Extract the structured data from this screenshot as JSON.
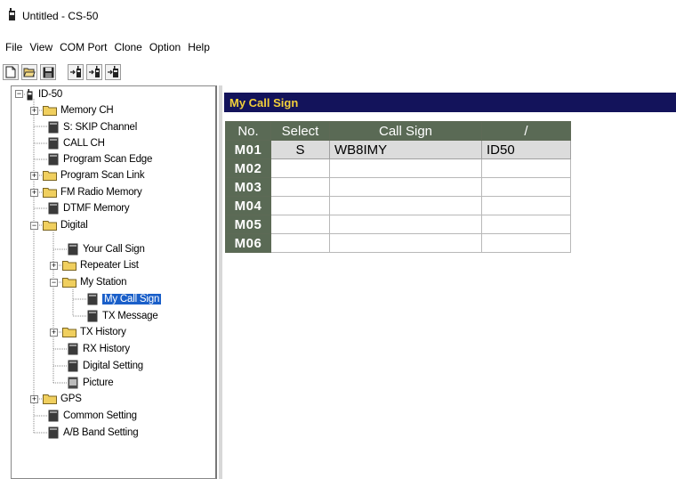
{
  "window": {
    "title": "Untitled - CS-50"
  },
  "menu": [
    "File",
    "View",
    "COM Port",
    "Clone",
    "Option",
    "Help"
  ],
  "toolbar": {
    "buttons": [
      "new-file-icon",
      "open-folder-icon",
      "save-icon",
      "read-radio-icon",
      "write-radio-icon",
      "write-radio-alt-icon"
    ]
  },
  "tree": {
    "root": "ID-50",
    "items": [
      {
        "label": "Memory CH"
      },
      {
        "label": "S: SKIP Channel"
      },
      {
        "label": "CALL CH"
      },
      {
        "label": "Program Scan Edge"
      },
      {
        "label": "Program Scan Link"
      },
      {
        "label": "FM Radio Memory"
      },
      {
        "label": "DTMF Memory"
      },
      {
        "label": "Digital"
      },
      {
        "label": "Your Call Sign"
      },
      {
        "label": "Repeater List"
      },
      {
        "label": "My Station"
      },
      {
        "label": "My Call Sign"
      },
      {
        "label": "TX Message"
      },
      {
        "label": "TX History"
      },
      {
        "label": "RX History"
      },
      {
        "label": "Digital Setting"
      },
      {
        "label": "Picture"
      },
      {
        "label": "GPS"
      },
      {
        "label": "Common Setting"
      },
      {
        "label": "A/B Band Setting"
      }
    ]
  },
  "content": {
    "header": "My Call Sign",
    "columns": [
      "No.",
      "Select",
      "Call Sign",
      "/"
    ],
    "rows": [
      {
        "no": "M01",
        "select": "S",
        "call_sign": "WB8IMY",
        "suffix": "ID50"
      },
      {
        "no": "M02",
        "select": "",
        "call_sign": "",
        "suffix": ""
      },
      {
        "no": "M03",
        "select": "",
        "call_sign": "",
        "suffix": ""
      },
      {
        "no": "M04",
        "select": "",
        "call_sign": "",
        "suffix": ""
      },
      {
        "no": "M05",
        "select": "",
        "call_sign": "",
        "suffix": ""
      },
      {
        "no": "M06",
        "select": "",
        "call_sign": "",
        "suffix": ""
      }
    ]
  },
  "colors": {
    "header_bg": "#13135b",
    "header_text": "#f2cf3a",
    "grid_header_bg": "#5a6a55",
    "selection": "#1a5fc9"
  }
}
